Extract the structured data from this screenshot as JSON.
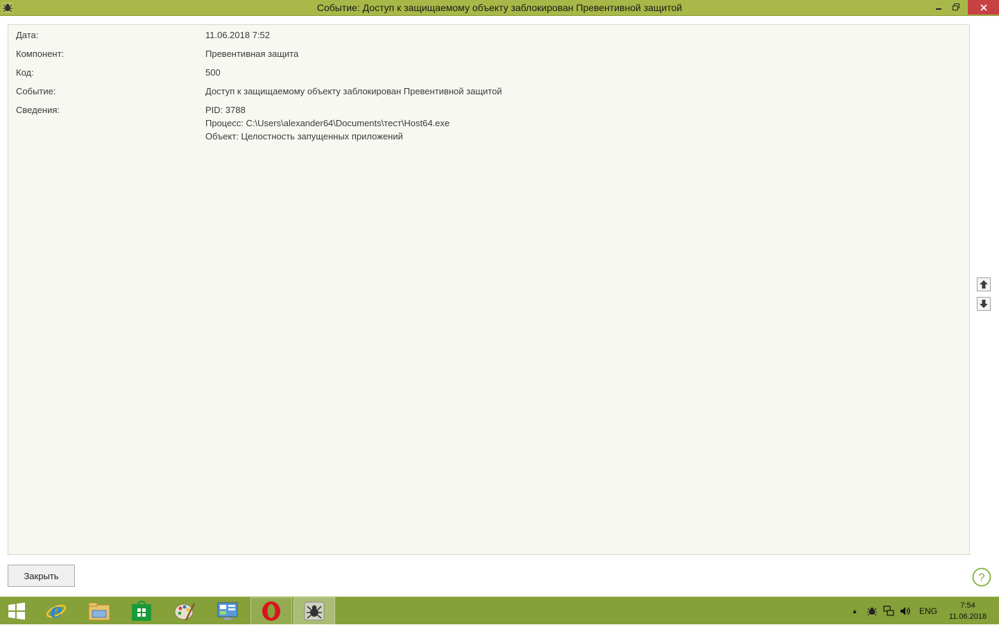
{
  "window": {
    "title": "Событие: Доступ к защищаемому объекту заблокирован Превентивной защитой",
    "titlebar_color": "#a8b848",
    "close_color": "#c74142"
  },
  "details": {
    "date_label": "Дата:",
    "date_value": "11.06.2018 7:52",
    "component_label": "Компонент:",
    "component_value": "Превентивная защита",
    "code_label": "Код:",
    "code_value": "500",
    "event_label": "Событие:",
    "event_value": "Доступ к защищаемому объекту заблокирован Превентивной защитой",
    "info_label": "Сведения:",
    "info_lines": [
      "PID: 3788",
      "Процесс: C:\\Users\\alexander64\\Documents\\тест\\Host64.exe",
      "Объект: Целостность запущенных приложений"
    ]
  },
  "buttons": {
    "close_label": "Закрыть",
    "help_symbol": "?"
  },
  "taskbar": {
    "items": [
      "start-icon",
      "ie-icon",
      "explorer-icon",
      "store-icon",
      "paint-icon",
      "control-panel-icon",
      "opera-icon",
      "drweb-icon"
    ],
    "lang": "ENG",
    "time": "7:54",
    "date": "11.06.2018",
    "tray_expand": "▲"
  }
}
